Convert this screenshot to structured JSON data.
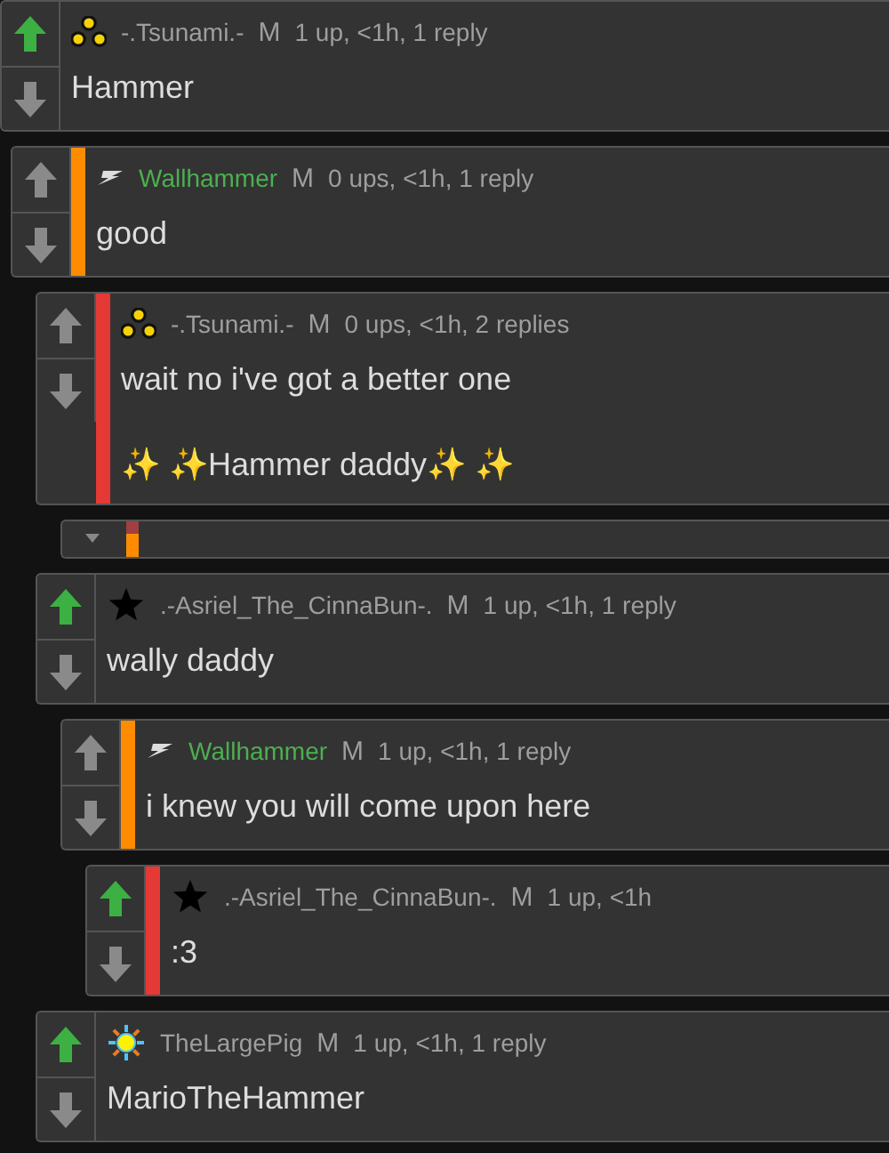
{
  "comments": [
    {
      "kind": "comment",
      "avatar": {
        "kind": "dots"
      },
      "user": "-.Tsunami.-",
      "user_highlighted": false,
      "badge": "M",
      "meta": "1 up, <1h, 1 reply",
      "upvoted": true,
      "body": [
        "Hammer"
      ],
      "children": [
        {
          "kind": "comment",
          "color": "#ff8c00",
          "avatar": {
            "kind": "bolt"
          },
          "user": "Wallhammer",
          "user_highlighted": true,
          "badge": "M",
          "meta": "0 ups, <1h, 1 reply",
          "upvoted": false,
          "body": [
            "good"
          ],
          "children": [
            {
              "kind": "comment",
              "color": "#e53935",
              "avatar": {
                "kind": "dots"
              },
              "user": "-.Tsunami.-",
              "user_highlighted": false,
              "badge": "M",
              "meta": "0 ups, <1h, 2 replies",
              "upvoted": false,
              "body": [
                "wait no i've got a better one",
                "✨ ✨Hammer daddy✨ ✨"
              ],
              "children": [
                {
                  "kind": "collapsed"
                }
              ]
            },
            {
              "kind": "comment",
              "avatar": {
                "kind": "star"
              },
              "user": ".-Asriel_The_CinnaBun-.",
              "user_highlighted": false,
              "badge": "M",
              "meta": "1 up, <1h, 1 reply",
              "upvoted": true,
              "body": [
                "wally daddy"
              ],
              "children": [
                {
                  "kind": "comment",
                  "color": "#ff8c00",
                  "avatar": {
                    "kind": "bolt"
                  },
                  "user": "Wallhammer",
                  "user_highlighted": true,
                  "badge": "M",
                  "meta": "1 up, <1h, 1 reply",
                  "upvoted": false,
                  "body": [
                    "i knew you will come upon here"
                  ],
                  "children": [
                    {
                      "kind": "comment",
                      "color": "#e53935",
                      "avatar": {
                        "kind": "star"
                      },
                      "user": ".-Asriel_The_CinnaBun-.",
                      "user_highlighted": false,
                      "badge": "M",
                      "meta": "1 up, <1h",
                      "upvoted": true,
                      "body": [
                        ":3"
                      ]
                    }
                  ]
                }
              ]
            },
            {
              "kind": "comment",
              "avatar": {
                "kind": "sun"
              },
              "user": "TheLargePig",
              "user_highlighted": false,
              "badge": "M",
              "meta": "1 up, <1h, 1 reply",
              "upvoted": true,
              "body": [
                "MarioTheHammer"
              ]
            }
          ]
        }
      ]
    }
  ]
}
